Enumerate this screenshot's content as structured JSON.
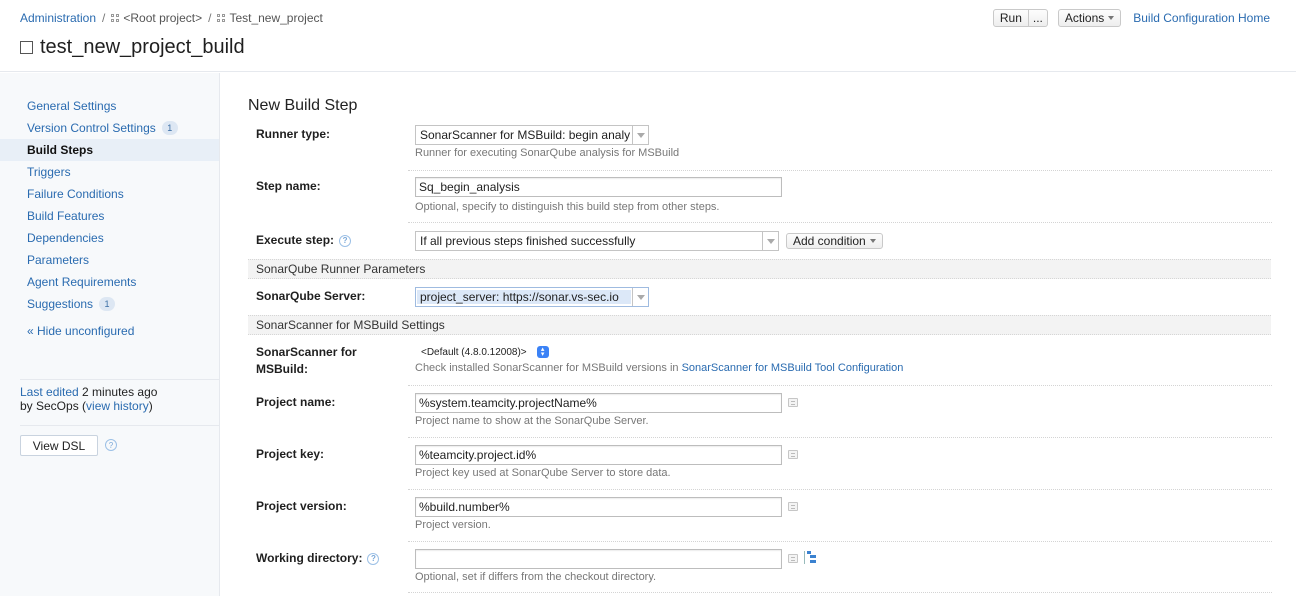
{
  "breadcrumb": {
    "items": [
      "Administration",
      "<Root project>",
      "Test_new_project"
    ],
    "separator": "/"
  },
  "page": {
    "title": "test_new_project_build"
  },
  "header_actions": {
    "run": "Run",
    "run_more": "...",
    "actions": "Actions",
    "home_link": "Build Configuration Home"
  },
  "sidebar": {
    "items": [
      {
        "label": "General Settings",
        "badge": null,
        "active": false
      },
      {
        "label": "Version Control Settings",
        "badge": "1",
        "active": false
      },
      {
        "label": "Build Steps",
        "badge": null,
        "active": true
      },
      {
        "label": "Triggers",
        "badge": null,
        "active": false
      },
      {
        "label": "Failure Conditions",
        "badge": null,
        "active": false
      },
      {
        "label": "Build Features",
        "badge": null,
        "active": false
      },
      {
        "label": "Dependencies",
        "badge": null,
        "active": false
      },
      {
        "label": "Parameters",
        "badge": null,
        "active": false
      },
      {
        "label": "Agent Requirements",
        "badge": null,
        "active": false
      },
      {
        "label": "Suggestions",
        "badge": "1",
        "active": false
      }
    ],
    "hide_unconfigured": "« Hide unconfigured",
    "last_edited_link": "Last edited",
    "last_edited_time": " 2 minutes ago",
    "last_edited_by": "by SecOps  (",
    "view_history": "view history",
    "close_paren": ")",
    "view_dsl": "View DSL",
    "help_glyph": "?"
  },
  "form": {
    "section_title": "New Build Step",
    "runner_type": {
      "label": "Runner type:",
      "value": "SonarScanner for MSBuild: begin analy",
      "hint": "Runner for executing SonarQube analysis for MSBuild"
    },
    "step_name": {
      "label": "Step name:",
      "value": "Sq_begin_analysis",
      "hint": "Optional, specify to distinguish this build step from other steps."
    },
    "execute_step": {
      "label": "Execute step:",
      "value": "If all previous steps finished successfully",
      "add_condition": "Add condition"
    },
    "group_runner_params": "SonarQube Runner Parameters",
    "sonarqube_server": {
      "label": "SonarQube Server:",
      "value": "project_server: https://sonar.vs-sec.io"
    },
    "group_msbuild_settings": "SonarScanner for MSBuild Settings",
    "scanner_version": {
      "label_line1": "SonarScanner for",
      "label_line2": "MSBuild:",
      "value": "<Default (4.8.0.12008)>",
      "hint_prefix": "Check installed SonarScanner for MSBuild versions in ",
      "hint_link": "SonarScanner for MSBuild Tool Configuration"
    },
    "project_name": {
      "label": "Project name:",
      "value": "%system.teamcity.projectName%",
      "hint": "Project name to show at the SonarQube Server."
    },
    "project_key": {
      "label": "Project key:",
      "value": "%teamcity.project.id%",
      "hint": "Project key used at SonarQube Server to store data."
    },
    "project_version": {
      "label": "Project version:",
      "value": "%build.number%",
      "hint": "Project version."
    },
    "working_directory": {
      "label": "Working directory:",
      "value": "",
      "hint": "Optional, set if differs from the checkout directory."
    }
  }
}
